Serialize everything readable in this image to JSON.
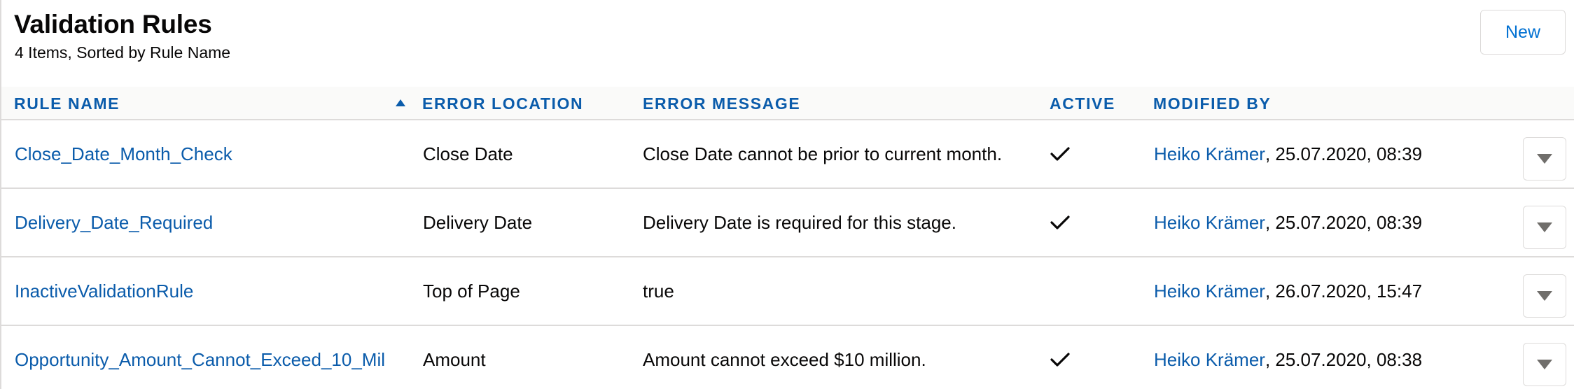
{
  "header": {
    "title": "Validation Rules",
    "subtitle": "4 Items, Sorted by Rule Name",
    "new_button": "New"
  },
  "columns": {
    "rule_name": "RULE NAME",
    "error_location": "ERROR LOCATION",
    "error_message": "ERROR MESSAGE",
    "active": "ACTIVE",
    "modified_by": "MODIFIED BY"
  },
  "rows": [
    {
      "rule_name": "Close_Date_Month_Check",
      "error_location": "Close Date",
      "error_message": "Close Date cannot be prior to current month.",
      "active": true,
      "modified_by_user": "Heiko Krämer",
      "modified_at": ", 25.07.2020, 08:39"
    },
    {
      "rule_name": "Delivery_Date_Required",
      "error_location": "Delivery Date",
      "error_message": "Delivery Date is required for this stage.",
      "active": true,
      "modified_by_user": "Heiko Krämer",
      "modified_at": ", 25.07.2020, 08:39"
    },
    {
      "rule_name": "InactiveValidationRule",
      "error_location": "Top of Page",
      "error_message": "true",
      "active": false,
      "modified_by_user": "Heiko Krämer",
      "modified_at": ", 26.07.2020, 15:47"
    },
    {
      "rule_name": "Opportunity_Amount_Cannot_Exceed_10_Mil",
      "error_location": "Amount",
      "error_message": "Amount cannot exceed $10 million.",
      "active": true,
      "modified_by_user": "Heiko Krämer",
      "modified_at": ", 25.07.2020, 08:38"
    }
  ],
  "icons": {
    "sort": "arrow-up-icon",
    "active": "check-icon",
    "row_menu": "chevron-down-icon"
  },
  "colors": {
    "link": "#0b5cab",
    "header_background": "#fafaf9",
    "border": "#dddbda"
  }
}
